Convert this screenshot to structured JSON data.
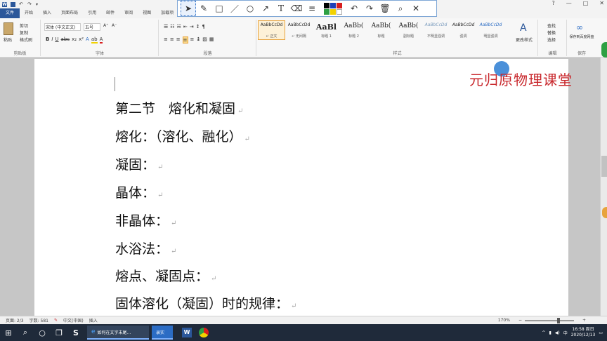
{
  "titlebar": {
    "title": "",
    "controls": [
      "?",
      "—",
      "□",
      "✕"
    ]
  },
  "tabs": [
    "文件",
    "开始",
    "插入",
    "页面布局",
    "引用",
    "邮件",
    "审阅",
    "视图",
    "加载项"
  ],
  "ribbon": {
    "clipboard": {
      "paste": "粘贴",
      "cut": "剪切",
      "copy": "复制",
      "painter": "格式刷",
      "label": "剪贴板"
    },
    "font": {
      "name": "宋体 (中文正文)",
      "size": "五号",
      "grow": "A⁺",
      "shrink": "A⁻",
      "bold": "B",
      "italic": "I",
      "underline": "U",
      "label": "字体"
    },
    "paragraph": {
      "label": "段落"
    },
    "styles": {
      "label": "样式",
      "items": [
        {
          "sample": "AaBbCcDd",
          "name": "↵ 正文"
        },
        {
          "sample": "AaBbCcDd",
          "name": "↵ 无间隔"
        },
        {
          "sample": "AaBl",
          "name": "标题 1"
        },
        {
          "sample": "AaBb(",
          "name": "标题 2"
        },
        {
          "sample": "AaBb(",
          "name": "标题"
        },
        {
          "sample": "AaBb(",
          "name": "副标题"
        },
        {
          "sample": "AaBbCcDd",
          "name": "不明显强调"
        },
        {
          "sample": "AaBbCcDd",
          "name": "强调"
        },
        {
          "sample": "AaBbCcDd",
          "name": "明显强调"
        }
      ],
      "change_styles": "更改样式"
    },
    "editing": {
      "find": "查找",
      "replace": "替换",
      "select": "选择",
      "label": "编辑"
    },
    "save": {
      "label": "保存到百度网盘",
      "group": "保存"
    }
  },
  "annotation_toolbar": {
    "colors": [
      "#000000",
      "#1e3fb8",
      "#d81e1e",
      "#2ea043",
      "#f2d200",
      "#ffffff"
    ]
  },
  "document": {
    "watermark": "元归原物理课堂",
    "lines": [
      "第二节　熔化和凝固",
      "熔化：（溶化、融化）",
      "凝固：",
      "晶体：",
      "非晶体：",
      "水浴法：",
      "熔点、凝固点：",
      "固体溶化（凝固）时的规律："
    ]
  },
  "statusbar": {
    "page": "页面: 2/3",
    "words": "字数: 581",
    "lang": "中文(中国)",
    "mode": "插入",
    "zoom": "170%"
  },
  "taskbar": {
    "ie_task": "如何在文字末尾...",
    "rec_task": "录实",
    "time": "16:58 周日",
    "date": "2020/12/13"
  }
}
